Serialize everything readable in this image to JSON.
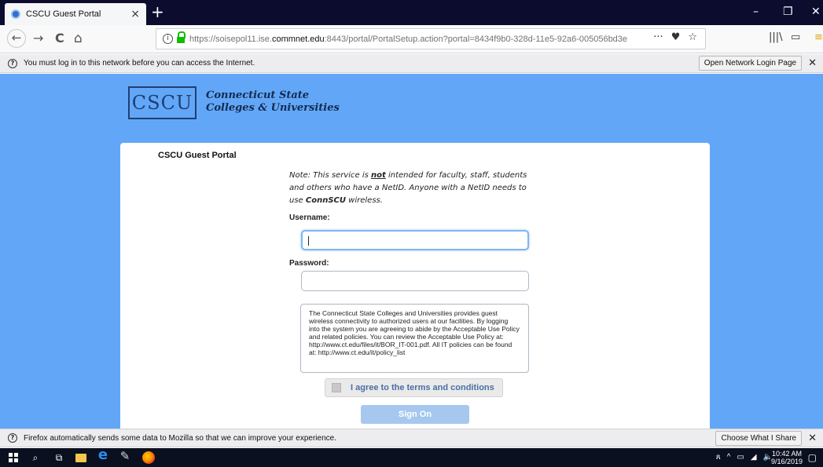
{
  "browser": {
    "tab_title": "CSCU Guest Portal",
    "tab_close": "×",
    "new_tab": "+",
    "window_controls": {
      "minimize": "–",
      "maximize": "❐",
      "close": "✕"
    },
    "nav": {
      "back": "←",
      "forward": "→",
      "reload": "C",
      "home": "⌂"
    },
    "url_host_prefix": "https://soisepol11.ise.",
    "url_host": "commnet.edu",
    "url_rest": ":8443/portal/PortalSetup.action?portal=8434f9b0-328d-11e5-92a6-005056bd3e",
    "url_actions": {
      "more": "···",
      "pocket": "♥",
      "bookmark": "☆"
    },
    "library_icon": "|||\\",
    "sidebar_icon": "▭",
    "menu_icon": "≡"
  },
  "top_notification": {
    "text": "You must log in to this network before you can access the Internet.",
    "button": "Open Network Login Page",
    "close": "✕"
  },
  "bottom_notification": {
    "text": "Firefox automatically sends some data to Mozilla so that we can improve your experience.",
    "button": "Choose What I Share",
    "close": "✕"
  },
  "page": {
    "logo_mark": "CSCU",
    "logo_line1": "Connecticut State",
    "logo_line2": "Colleges & Universities",
    "portal_title": "CSCU Guest Portal",
    "note_prefix": "Note: This service is ",
    "note_not": "not",
    "note_mid": " intended for faculty, staff, students and others who have a NetID.  Anyone with a NetID needs to use ",
    "note_connscu": "ConnSCU",
    "note_suffix": " wireless.",
    "username_label": "Username:",
    "password_label": "Password:",
    "terms_text": "The Connecticut State Colleges and Universities provides guest wireless connectivity to authorized users at our facilities. By logging into the system you are agreeing to abide by the Acceptable Use Policy and related policies. You can review the Acceptable Use Policy at: http://www.ct.edu/files/it/BOR_IT-001.pdf. All IT policies can be found at: http://www.ct.edu/it/policy_list",
    "agree_label": "I agree to the terms and conditions",
    "sign_on": "Sign On"
  },
  "taskbar": {
    "time": "10:42 AM",
    "date": "9/16/2019",
    "tray_people": "ጸ",
    "tray_up": "^",
    "tray_battery": "▭",
    "tray_wifi": "◢",
    "tray_volume": "🔈",
    "notifications": "▢"
  }
}
